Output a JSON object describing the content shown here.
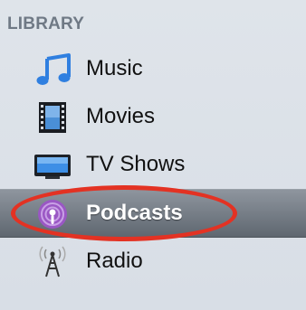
{
  "sidebar": {
    "section_title": "LIBRARY",
    "items": [
      {
        "label": "Music",
        "icon": "music-note-icon"
      },
      {
        "label": "Movies",
        "icon": "film-icon"
      },
      {
        "label": "TV Shows",
        "icon": "tv-icon"
      },
      {
        "label": "Podcasts",
        "icon": "podcast-icon",
        "selected": true
      },
      {
        "label": "Radio",
        "icon": "radio-tower-icon"
      }
    ]
  },
  "colors": {
    "selection": "#6a727b",
    "annotation_ring": "#e33223",
    "music_icon": "#2f7fe0"
  }
}
